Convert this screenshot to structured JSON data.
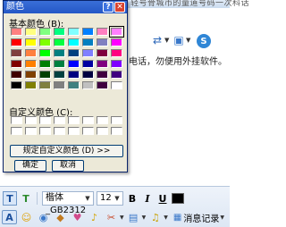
{
  "background": {
    "topbar_text": "轻号骨城市的量道号码一次科话",
    "warning_text": "电话，勿便用外挂软件。",
    "font_toolbar": {
      "font_name": "楷体_GB2312",
      "font_size": "12",
      "bold_label": "B",
      "italic_label": "I",
      "underline_label": "U"
    },
    "history_label": "消息记录"
  },
  "dialog": {
    "title": "颜色",
    "help_label": "?",
    "close_label": "✕",
    "basic_colors_label": "基本颜色 (B):",
    "custom_colors_label": "自定义颜色 (C):",
    "define_custom_label": "规定自定义颜色 (D) >>",
    "ok_label": "确定",
    "cancel_label": "取消",
    "selected_index": 7,
    "basic_colors": [
      "#ff8080",
      "#ffff80",
      "#80ff80",
      "#00ff80",
      "#80ffff",
      "#0080ff",
      "#ff80c0",
      "#ff80ff",
      "#ff0000",
      "#ffff00",
      "#80ff00",
      "#00ff40",
      "#00ffff",
      "#0080c0",
      "#8080c0",
      "#ff00ff",
      "#804040",
      "#ff8040",
      "#00ff00",
      "#008080",
      "#004080",
      "#8080ff",
      "#800040",
      "#ff0080",
      "#800000",
      "#ff8000",
      "#008000",
      "#008040",
      "#0000ff",
      "#0000a0",
      "#800080",
      "#8000ff",
      "#400000",
      "#804000",
      "#004000",
      "#004040",
      "#000080",
      "#000040",
      "#400040",
      "#400080",
      "#000000",
      "#808000",
      "#808040",
      "#808080",
      "#408080",
      "#c0c0c0",
      "#400040",
      "#ffffff"
    ],
    "custom_colors": [
      "#ffffff",
      "#ffffff",
      "#ffffff",
      "#ffffff",
      "#ffffff",
      "#ffffff",
      "#ffffff",
      "#ffffff",
      "#ffffff",
      "#ffffff",
      "#ffffff",
      "#ffffff",
      "#ffffff",
      "#ffffff",
      "#ffffff",
      "#ffffff"
    ]
  }
}
